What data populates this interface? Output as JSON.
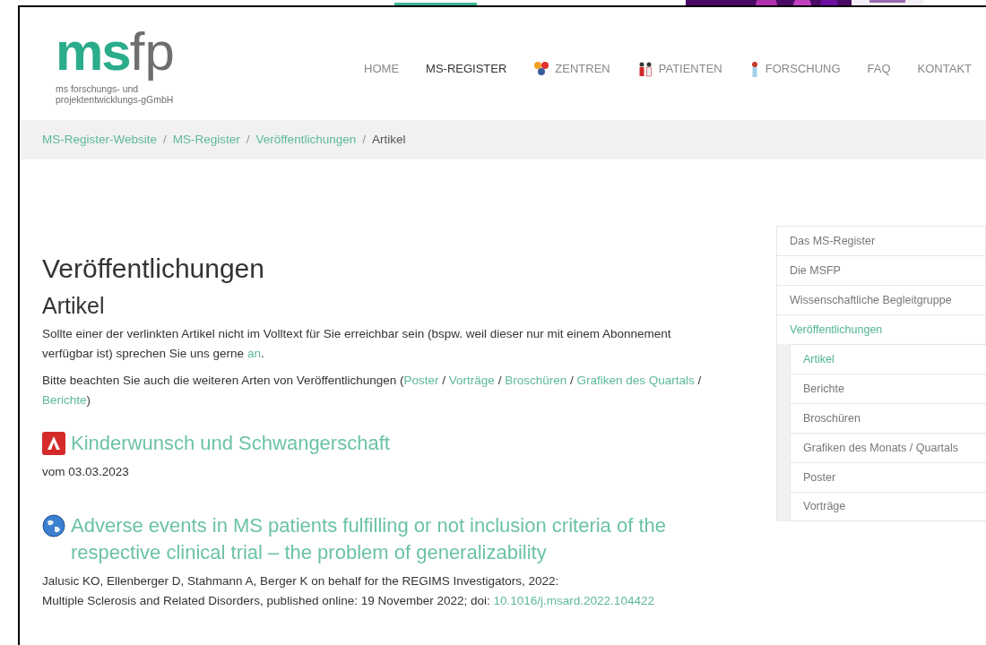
{
  "logo": {
    "mark_a": "ms",
    "mark_b": "fp",
    "subtitle": [
      "ms forschungs- und",
      "projektentwicklungs-gGmbH"
    ]
  },
  "nav": [
    {
      "label": "HOME",
      "kind": "plain",
      "selected": false
    },
    {
      "label": "MS-REGISTER",
      "kind": "plain",
      "selected": true
    },
    {
      "label": "ZENTREN",
      "kind": "circles",
      "selected": false
    },
    {
      "label": "PATIENTEN",
      "kind": "people",
      "selected": false
    },
    {
      "label": "FORSCHUNG",
      "kind": "person",
      "selected": false
    },
    {
      "label": "FAQ",
      "kind": "plain",
      "selected": false
    },
    {
      "label": "KONTAKT",
      "kind": "plain",
      "selected": false
    }
  ],
  "breadcrumbs": [
    {
      "label": "MS-Register-Website",
      "kind": "link"
    },
    {
      "separator": "/",
      "label": "MS-Register",
      "kind": "link"
    },
    {
      "separator": "/",
      "label": "Veröffentlichungen",
      "kind": "link"
    },
    {
      "separator": "/",
      "label": "Artikel",
      "kind": "current"
    }
  ],
  "page_title": "Veröffentlichungen",
  "section_title": "Artikel",
  "paragraphs": [
    [
      {
        "text": "Sollte einer der verlinkten Artikel nicht im Volltext für Sie erreichbar sein (bspw. weil dieser nur mit einem Abonnement verfügbar ist) sprechen Sie uns gerne ",
        "kind": "text"
      },
      {
        "text": "an",
        "kind": "link"
      },
      {
        "text": ".",
        "kind": "text"
      }
    ],
    [
      {
        "text": "Bitte beachten Sie auch die weiteren Arten von Veröffentlichungen (",
        "kind": "text"
      },
      {
        "text": "Poster",
        "kind": "link"
      },
      {
        "text": " / ",
        "kind": "text"
      },
      {
        "text": "Vorträge",
        "kind": "link"
      },
      {
        "text": " / ",
        "kind": "text"
      },
      {
        "text": "Broschüren",
        "kind": "link"
      },
      {
        "text": " / ",
        "kind": "text"
      },
      {
        "text": "Grafiken des Quartals",
        "kind": "link"
      },
      {
        "text": " / ",
        "kind": "text"
      },
      {
        "text": "Berichte",
        "kind": "link"
      },
      {
        "text": ")",
        "kind": "text"
      }
    ]
  ],
  "articles": [
    {
      "kind": "pdf",
      "title": "Kinderwunsch und Schwangerschaft",
      "lines": [
        [
          {
            "text": "vom 03.03.2023",
            "kind": "text"
          }
        ]
      ]
    },
    {
      "kind": "web",
      "title": "Adverse events in MS patients fulfilling or not inclusion criteria of the respective clinical trial – the problem of generalizability",
      "lines": [
        [
          {
            "text": "Jalusic KO, Ellenberger D, Stahmann A, Berger K on behalf for the REGIMS Investigators, 2022:",
            "kind": "text"
          }
        ],
        [
          {
            "text": "Multiple Sclerosis and Related Disorders, published online: 19 November 2022; doi: ",
            "kind": "text"
          },
          {
            "text": "10.1016/j.msard.2022.104422",
            "kind": "link"
          }
        ]
      ]
    }
  ],
  "sidebar": [
    {
      "label": "Das MS-Register",
      "selected": false
    },
    {
      "label": "Die MSFP",
      "selected": false
    },
    {
      "label": "Wissenschaftliche Begleitgruppe",
      "selected": false
    },
    {
      "label": "Veröffentlichungen",
      "selected": true,
      "children": [
        {
          "label": "Artikel",
          "selected": true
        },
        {
          "label": "Berichte",
          "selected": false
        },
        {
          "label": "Broschüren",
          "selected": false
        },
        {
          "label": "Grafiken des Monats / Quartals",
          "selected": false
        },
        {
          "label": "Poster",
          "selected": false
        },
        {
          "label": "Vorträge",
          "selected": false
        }
      ]
    }
  ]
}
